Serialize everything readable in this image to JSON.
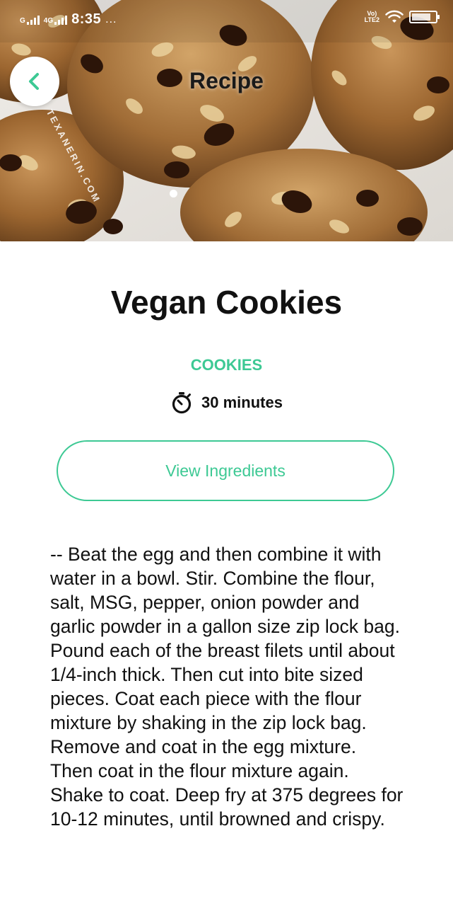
{
  "status_bar": {
    "network_label": "G",
    "network_type": "4G",
    "time": "8:35",
    "overflow_dots": "...",
    "volte_top": "Vo)",
    "volte_bottom": "LTE2"
  },
  "header": {
    "title": "Recipe",
    "watermark": "TEXANERIN.COM",
    "back_icon": "chevron-left-icon"
  },
  "carousel": {
    "page_count": 1,
    "active_index": 0
  },
  "recipe": {
    "title": "Vegan Cookies",
    "category": "COOKIES",
    "duration": "30 minutes",
    "duration_icon": "stopwatch-icon",
    "ingredients_button_label": "View Ingredients",
    "instructions": "-- Beat the egg and then combine it with water in a bowl. Stir. Combine the flour, salt, MSG, pepper, onion powder and garlic powder in a gallon size zip lock bag. Pound each of the breast filets until about 1/4-inch thick. Then cut into bite sized pieces. Coat each piece with the flour mixture by shaking in the zip lock bag. Remove and coat in the egg mixture. Then coat in the flour mixture again. Shake to coat. Deep fry at 375 degrees for 10-12 minutes, until browned and crispy."
  },
  "colors": {
    "accent": "#3dc994",
    "text": "#111111",
    "background": "#ffffff"
  }
}
